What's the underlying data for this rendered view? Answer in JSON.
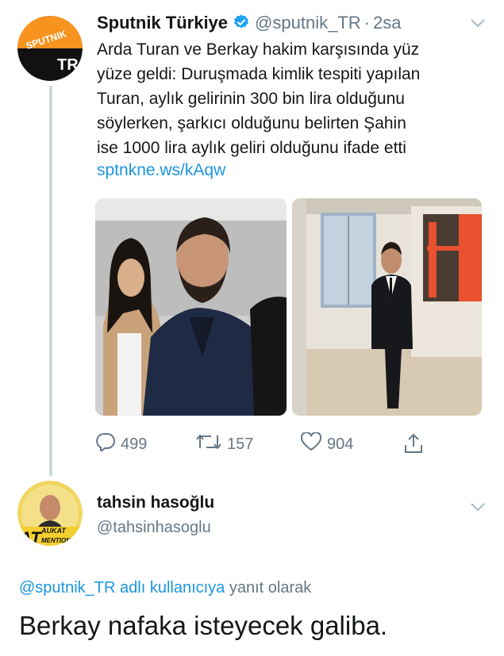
{
  "tweet": {
    "author_name": "Sputnik Türkiye",
    "handle": "@sputnik_TR",
    "separator": "·",
    "time": "2sa",
    "text_lines": [
      "Arda Turan ve Berkay hakim karşısında yüz",
      "yüze geldi: Duruşmada kimlik tespiti yapılan",
      "Turan, aylık gelirinin 300 bin lira olduğunu",
      "söylerken, şarkıcı olduğunu belirten Şahin",
      "ise 1000 lira aylık geliri olduğunu ifade etti"
    ],
    "link": "sptnkne.ws/kAqw",
    "avatar_logo_top": "SPUTNIK",
    "avatar_logo_bottom": "TR",
    "actions": {
      "reply_count": "499",
      "retweet_count": "157",
      "like_count": "904"
    }
  },
  "reply": {
    "author_name": "tahsin hasoğlu",
    "handle": "@tahsinhasoglu",
    "avatar_badge_main": "AT",
    "avatar_badge_top": "AUKAT",
    "avatar_badge_bottom": "MENTION",
    "replying_prefix": "@sputnik_TR adlı kullanıcıya",
    "replying_suffix": "yanıt olarak",
    "text": "Berkay nafaka isteyecek galiba."
  },
  "colors": {
    "link": "#1b95e0",
    "muted": "#657786",
    "verified": "#1da1f2",
    "sputnik_orange": "#f7931e"
  },
  "icons": [
    "verified-badge-icon",
    "chevron-down-icon",
    "reply-icon",
    "retweet-icon",
    "like-icon",
    "share-icon"
  ]
}
